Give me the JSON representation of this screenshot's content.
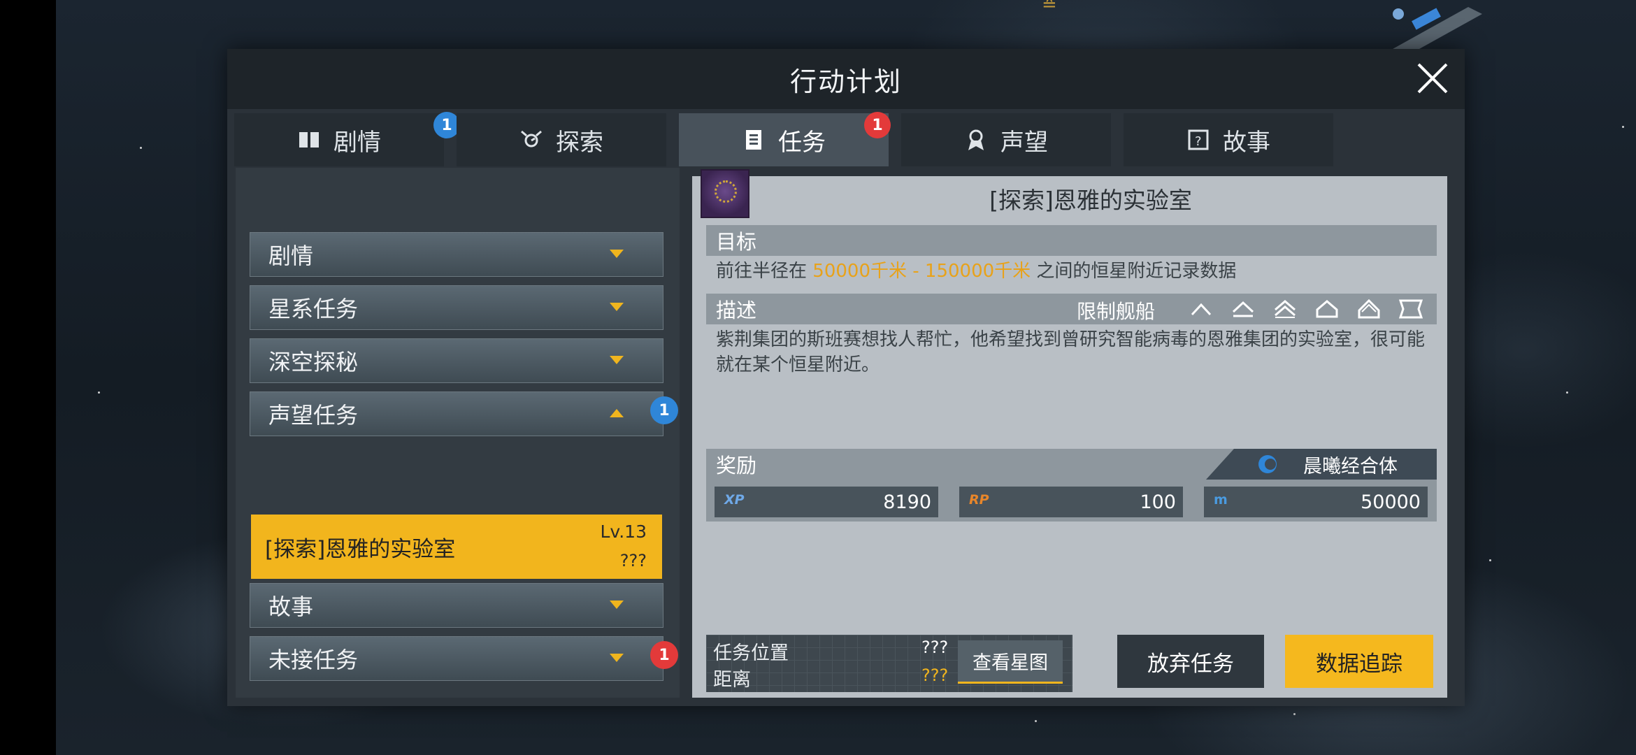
{
  "dialog": {
    "title": "行动计划"
  },
  "tabs": [
    {
      "label": "剧情",
      "icon": "book-icon",
      "badge": "1",
      "badge_color": "#2f86d8"
    },
    {
      "label": "探索",
      "icon": "explore-icon",
      "badge": ""
    },
    {
      "label": "任务",
      "icon": "task-icon",
      "badge": "1",
      "badge_color": "#e33a3a",
      "active": true
    },
    {
      "label": "声望",
      "icon": "reputation-icon",
      "badge": ""
    },
    {
      "label": "故事",
      "icon": "story-icon",
      "badge": ""
    }
  ],
  "categories": [
    {
      "label": "剧情",
      "expanded": false
    },
    {
      "label": "星系任务",
      "expanded": false
    },
    {
      "label": "深空探秘",
      "expanded": false
    },
    {
      "label": "声望任务",
      "expanded": true,
      "badge": "1",
      "badge_color": "#2f86d8"
    },
    {
      "label": "故事",
      "expanded": false
    },
    {
      "label": "未接任务",
      "expanded": false,
      "badge": "1",
      "badge_color": "#e33a3a"
    }
  ],
  "selected_quest": {
    "name": "[探索]恩雅的实验室",
    "level": "Lv.13",
    "unknown": "???"
  },
  "detail": {
    "title": "[探索]恩雅的实验室",
    "objective_header": "目标",
    "objective_prefix": "前往半径在",
    "objective_range": "50000千米 - 150000千米",
    "objective_suffix": "之间的恒星附近记录数据",
    "description_header": "描述",
    "restrict_label": "限制舰船",
    "description": "紫荆集团的斯班赛想找人帮忙，他希望找到曾研究智能病毒的恩雅集团的实验室，很可能就在某个恒星附近。",
    "reward_header": "奖励",
    "faction": "晨曦经合体",
    "rewards": [
      {
        "icon": "XP",
        "value": "8190",
        "color": "#6fa9e8"
      },
      {
        "icon": "RP",
        "value": "100",
        "color": "#e8862a"
      },
      {
        "icon": "m",
        "value": "50000",
        "color": "#4a9be0"
      }
    ]
  },
  "location": {
    "label": "任务位置",
    "distance_label": "距离",
    "location_value": "???",
    "distance_value": "???",
    "starmap_button": "查看星图"
  },
  "actions": {
    "abandon": "放弃任务",
    "track": "数据追踪"
  },
  "colors": {
    "accent": "#f2b51d",
    "panel": "#2b3239",
    "highlight_text": "#e8a21a"
  }
}
